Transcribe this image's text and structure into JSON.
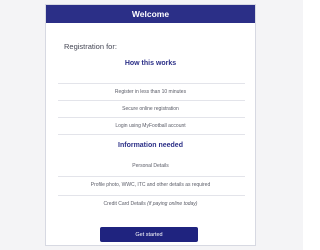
{
  "header": {
    "title": "Welcome"
  },
  "intro": {
    "text": "Registration for:"
  },
  "how_it_works": {
    "title": "How this works",
    "items": [
      "Register in less than 10 minutes",
      "Secure online registration",
      "Login using MyFootball account"
    ]
  },
  "info_needed": {
    "title": "Information needed",
    "items": [
      "Personal Details",
      "Profile photo, WWC, ITC and other details as required"
    ],
    "payment_prefix": "Credit Card Details ",
    "payment_note": "(if paying online today)"
  },
  "cta": {
    "label": "Get started"
  },
  "colors": {
    "brand": "#2b2f87",
    "button": "#1f237f",
    "page_bg": "#f4f4f6"
  }
}
